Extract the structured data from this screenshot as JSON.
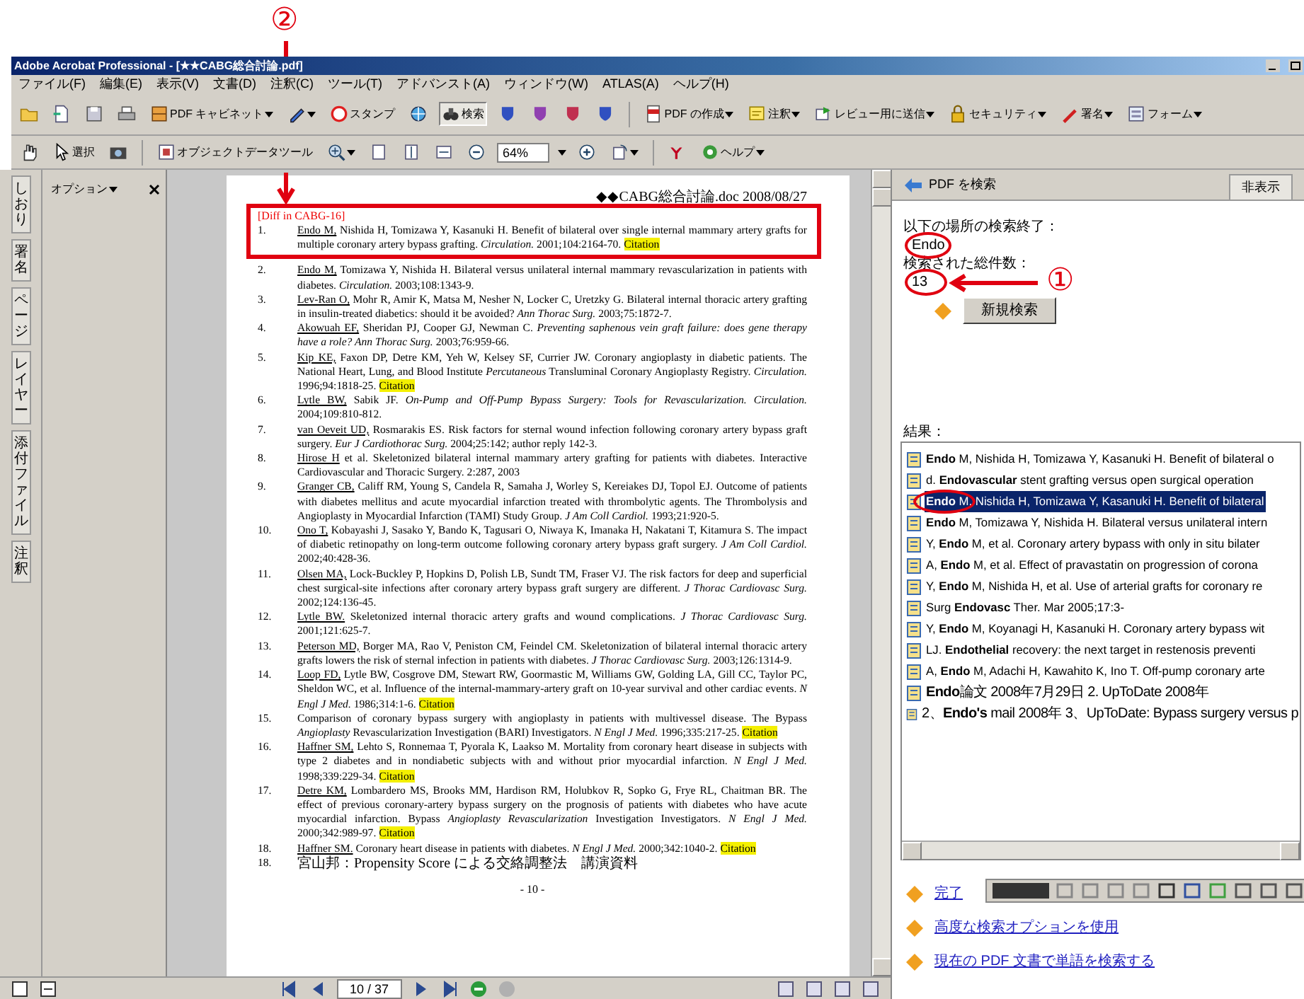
{
  "callouts": [
    {
      "label": "②"
    },
    {
      "label": "①"
    }
  ],
  "window": {
    "title": "Adobe Acrobat Professional - [★★CABG総合討論.pdf]"
  },
  "menu": [
    "ファイル(F)",
    "編集(E)",
    "表示(V)",
    "文書(D)",
    "注釈(C)",
    "ツール(T)",
    "アドバンスト(A)",
    "ウィンドウ(W)",
    "ATLAS(A)",
    "ヘルプ(H)"
  ],
  "toolbar_1": [
    {
      "label": "PDF キャビネット",
      "pressed": false
    },
    {
      "label": "スタンプ",
      "pressed": false
    },
    {
      "label": "検索",
      "pressed": true
    },
    {
      "label": "PDF の作成",
      "pressed": false
    },
    {
      "label": "注釈",
      "pressed": false
    },
    {
      "label": "レビュー用に送信",
      "pressed": false
    },
    {
      "label": "セキュリティ",
      "pressed": false
    },
    {
      "label": "署名",
      "pressed": false
    },
    {
      "label": "フォーム",
      "pressed": false
    }
  ],
  "toolbar_2": {
    "select": "選択",
    "object_tool": "オブジェクトデータツール",
    "zoom": "64%",
    "help": "ヘルプ"
  },
  "side_tabs": [
    "しおり",
    "署名",
    "ページ",
    "レイヤー",
    "添付ファイル",
    "注釈"
  ],
  "options_panel": {
    "title": "オプション"
  },
  "document": {
    "header": "◆◆CABG総合討論.doc 2008/08/27",
    "section": "[Diff in CABG-16]",
    "references": [
      {
        "number": "1.",
        "author": "Endo M,",
        "text": "Nishida H, Tomizawa Y, Kasanuki H. Benefit of bilateral over single internal mammary artery grafts for multiple coronary artery bypass grafting. *Circulation.* 2001;104:2164-70.",
        "citation": "Citation"
      },
      {
        "number": "2.",
        "author": "Endo M,",
        "text": "Tomizawa Y, Nishida H. Bilateral versus unilateral internal mammary revascularization in patients with diabetes. *Circulation.* 2003;108:1343-9."
      },
      {
        "number": "3.",
        "author": "Lev-Ran O,",
        "text": "Mohr R, Amir K, Matsa M, Nesher N, Locker C, Uretzky G. Bilateral internal thoracic artery grafting in insulin-treated diabetics: should it be avoided? *Ann Thorac Surg.* 2003;75:1872-7."
      },
      {
        "number": "4.",
        "author": "Akowuah EF,",
        "text": "Sheridan PJ, Cooper GJ, Newman C. *Preventing saphenous vein graft failure: does gene therapy have a role? Ann Thorac Surg.* 2003;76:959-66."
      },
      {
        "number": "5.",
        "author": "Kip KE,",
        "text": "Faxon DP, Detre KM, Yeh W, Kelsey SF, Currier JW. Coronary angioplasty in diabetic patients. The National Heart, Lung, and Blood Institute *Percutaneous* Transluminal Coronary Angioplasty Registry. *Circulation.* 1996;94:1818-25.",
        "citation": "Citation"
      },
      {
        "number": "6.",
        "author": "Lytle BW,",
        "text": "Sabik JF. *On-Pump and Off-Pump Bypass Surgery: Tools for Revascularization. Circulation.* 2004;109:810-812."
      },
      {
        "number": "7.",
        "author": "van Oeveit UD,",
        "text": "Rosmarakis ES. Risk factors for sternal wound infection following coronary artery bypass graft surgery. *Eur J Cardiothorac Surg.* 2004;25:142; author reply 142-3."
      },
      {
        "number": "8.",
        "author": "Hirose H",
        "text": "et al. Skeletonized bilateral internal mammary artery grafting for patients with diabetes. Interactive Cardiovascular and Thoracic Surgery. 2:287, 2003"
      },
      {
        "number": "9.",
        "author": "Granger CB,",
        "text": "Califf RM, Young S, Candela R, Samaha J, Worley S, Kereiakes DJ, Topol EJ. Outcome of patients with diabetes mellitus and acute myocardial infarction treated with thrombolytic agents. The Thrombolysis and Angioplasty in Myocardial Infarction (TAMI) Study Group. *J Am Coll Cardiol.* 1993;21:920-5."
      },
      {
        "number": "10.",
        "author": "Ono T,",
        "text": "Kobayashi J, Sasako Y, Bando K, Tagusari O, Niwaya K, Imanaka H, Nakatani T, Kitamura S. The impact of diabetic retinopathy on long-term outcome following coronary artery bypass graft surgery. *J Am Coll Cardiol.* 2002;40:428-36."
      },
      {
        "number": "11.",
        "author": "Olsen MA,",
        "text": "Lock-Buckley P, Hopkins D, Polish LB, Sundt TM, Fraser VJ. The risk factors for deep and superficial chest surgical-site infections after coronary artery bypass graft surgery are different. *J Thorac Cardiovasc Surg.* 2002;124:136-45."
      },
      {
        "number": "12.",
        "author": "Lytle BW.",
        "text": "Skeletonized internal thoracic artery grafts and wound complications. *J Thorac Cardiovasc Surg.* 2001;121:625-7."
      },
      {
        "number": "13.",
        "author": "Peterson MD,",
        "text": "Borger MA, Rao V, Peniston CM, Feindel CM. Skeletonization of bilateral internal thoracic artery grafts lowers the risk of sternal infection in patients with diabetes. *J Thorac Cardiovasc Surg.* 2003;126:1314-9."
      },
      {
        "number": "14.",
        "author": "Loop FD,",
        "text": "Lytle BW, Cosgrove DM, Stewart RW, Goormastic M, Williams GW, Golding LA, Gill CC, Taylor PC, Sheldon WC, et al. Influence of the internal-mammary-artery graft on 10-year survival and other cardiac events. *N Engl J Med.* 1986;314:1-6.",
        "citation": "Citation"
      },
      {
        "number": "15.",
        "text": "Comparison of coronary bypass surgery with angioplasty in patients with multivessel disease. The Bypass *Angioplasty* Revascularization Investigation (BARI) Investigators. *N Engl J Med.* 1996;335:217-25.",
        "citation": "Citation"
      },
      {
        "number": "16.",
        "author": "Haffner SM,",
        "text": "Lehto S, Ronnemaa T, Pyorala K, Laakso M. Mortality from coronary heart disease in subjects with type 2 diabetes and in nondiabetic subjects with and without prior myocardial infarction. *N Engl J Med.* 1998;339:229-34.",
        "citation": "Citation"
      },
      {
        "number": "17.",
        "author": "Detre KM,",
        "text": "Lombardero MS, Brooks MM, Hardison RM, Holubkov R, Sopko G, Frye RL, Chaitman BR. The effect of previous coronary-artery bypass surgery on the prognosis of patients with diabetes who have acute myocardial infarction. Bypass *Angioplasty Revascularization* Investigation Investigators. *N Engl J Med.* 2000;342:989-97.",
        "citation": "Citation"
      },
      {
        "number": "18.",
        "author": "Haffner SM.",
        "text": "Coronary heart disease in patients with diabetes. *N Engl J Med.* 2000;342:1040-2.",
        "citation": "Citation"
      },
      {
        "number": "18.",
        "text": "宮山邦：Propensity Score による交絡調整法　講演資料"
      }
    ],
    "footer": "- 10 -"
  },
  "search_panel": {
    "title": "PDF を検索",
    "hide_button": "非表示",
    "done_label": "以下の場所の検索終了：",
    "query": "Endo",
    "count_label": "検索された総件数：",
    "count": "13",
    "new_search_button": "新規検索",
    "results_label": "結果：",
    "results": [
      {
        "text": "**Endo** M, Nishida H, Tomizawa Y, Kasanuki H. Benefit of bilateral o",
        "selected": false
      },
      {
        "text": "d. **Endovascular** stent grafting versus open surgical operation",
        "selected": false
      },
      {
        "text": "**Endo** M, Nishida H, Tomizawa Y, Kasanuki H. Benefit of bilateral",
        "selected": true
      },
      {
        "text": "**Endo** M, Tomizawa Y, Nishida H. Bilateral versus unilateral intern",
        "selected": false
      },
      {
        "text": "Y, **Endo** M, et al. Coronary artery bypass with only in situ bilater",
        "selected": false
      },
      {
        "text": "A, **Endo** M, et al. Effect of pravastatin on progression of corona",
        "selected": false
      },
      {
        "text": "Y, **Endo** M, Nishida H, et al. Use of arterial grafts for coronary re",
        "selected": false
      },
      {
        "text": "Surg **Endovasc** Ther. Mar 2005;17:3-",
        "selected": false
      },
      {
        "text": "Y, **Endo** M, Koyanagi H, Kasanuki H. Coronary artery bypass wit",
        "selected": false
      },
      {
        "text": "LJ. **Endothelial** recovery: the next target in restenosis preventi",
        "selected": false
      },
      {
        "text": "A, **Endo** M, Adachi H, Kawahito K, Ino T. Off-pump coronary arte",
        "selected": false
      },
      {
        "text": "**Endo**論文 2008年7月29日 2. UpToDate 2008年",
        "selected": false
      },
      {
        "text": "2、**Endo's** mail 2008年 3、UpToDate: Bypass surgery versus p",
        "selected": false
      }
    ],
    "links": [
      "完了",
      "高度な検索オプションを使用",
      "現在の PDF 文書で単語を検索する"
    ]
  },
  "status_bar": {
    "page": "10 / 37"
  }
}
